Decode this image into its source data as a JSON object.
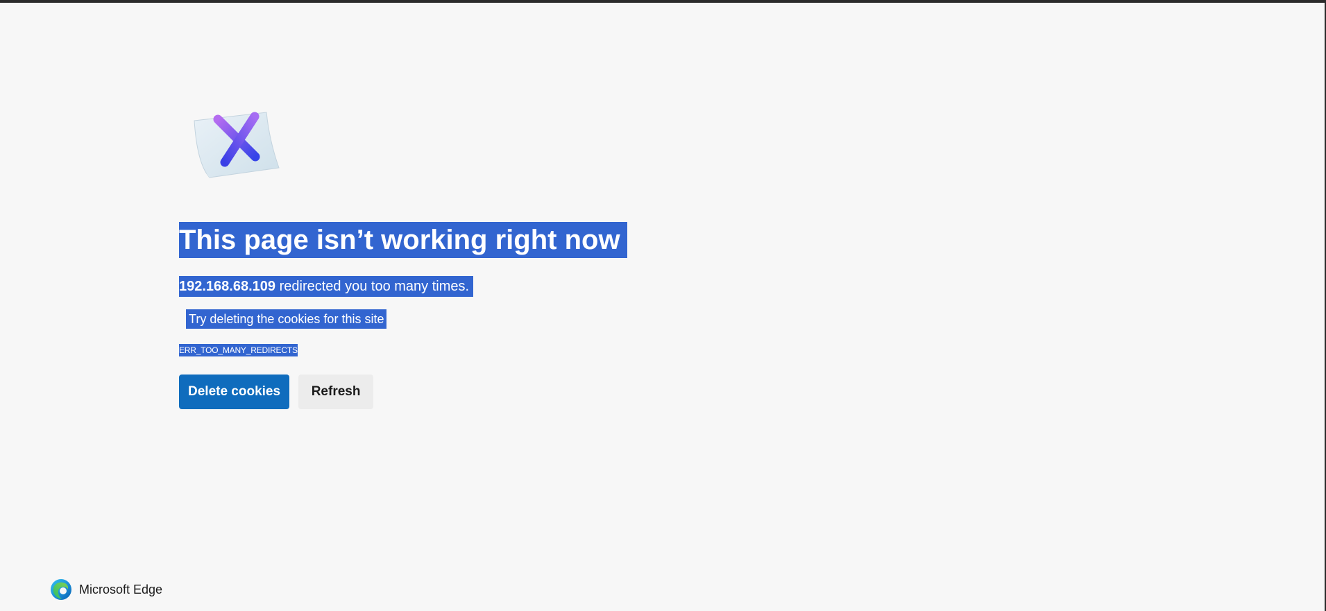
{
  "error_page": {
    "headline": "This page isn’t working right now",
    "host": "192.168.68.109",
    "redirect_message": " redirected you too many times.",
    "suggestion": "Try deleting the cookies for this site",
    "error_code": "ERR_TOO_MANY_REDIRECTS",
    "illustration_icon": "error-x-document-icon"
  },
  "actions": {
    "delete_cookies_label": "Delete cookies",
    "refresh_label": "Refresh"
  },
  "footer": {
    "brand_name": "Microsoft Edge",
    "logo_icon": "edge-logo-icon"
  },
  "colors": {
    "selection_highlight": "#3265d0",
    "primary_button": "#0f6cbd",
    "secondary_button": "#ececec",
    "page_background": "#f7f7f7"
  }
}
